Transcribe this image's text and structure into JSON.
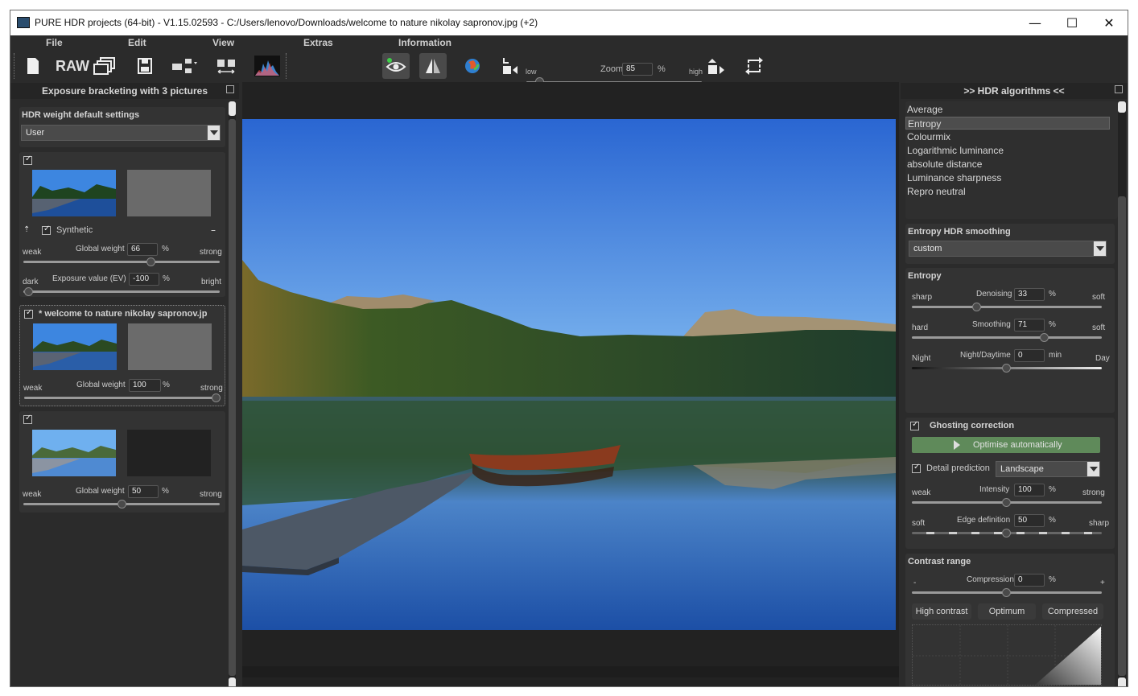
{
  "window": {
    "title": "PURE HDR projects (64-bit) - V1.15.02593 - C:/Users/lenovo/Downloads/welcome to nature nikolay sapronov.jpg (+2)",
    "minimize": "—",
    "maximize": "☐",
    "close": "✕"
  },
  "menu": [
    "File",
    "Edit",
    "View",
    "Extras",
    "Information"
  ],
  "toolbar": {
    "raw_label": "RAW",
    "zoom_label": "Zoom",
    "zoom_value": "85",
    "zoom_unit": "%",
    "low_label": "low",
    "high_label": "high",
    "slider_level_percent": 5
  },
  "left_panel": {
    "header": "Exposure bracketing with 3 pictures",
    "default_settings_title": "HDR weight default settings",
    "default_settings_value": "User",
    "synthetic_label": "Synthetic",
    "image1": {
      "weak": "weak",
      "strong": "strong",
      "global_weight_label": "Global weight",
      "global_weight": "66",
      "unit": "%",
      "dark": "dark",
      "bright": "bright",
      "ev_label": "Exposure value (EV)",
      "ev_value": "-100",
      "ev_unit": "%"
    },
    "image2": {
      "name": "* welcome to nature nikolay sapronov.jp",
      "weak": "weak",
      "strong": "strong",
      "global_weight_label": "Global weight",
      "global_weight": "100",
      "unit": "%"
    },
    "image3": {
      "weak": "weak",
      "strong": "strong",
      "global_weight_label": "Global weight",
      "global_weight": "50",
      "unit": "%"
    }
  },
  "right_panel": {
    "header": ">> HDR algorithms <<",
    "algorithms": [
      "Average",
      "Entropy",
      "Colourmix",
      "Logarithmic luminance",
      "absolute distance",
      "Luminance sharpness",
      "Repro neutral"
    ],
    "selected_algorithm": "Entropy",
    "smoothing_title": "Entropy HDR smoothing",
    "smoothing_value": "custom",
    "entropy_title": "Entropy",
    "denoising": {
      "left": "sharp",
      "label": "Denoising",
      "value": "33",
      "unit": "%",
      "right": "soft"
    },
    "smoothing": {
      "left": "hard",
      "label": "Smoothing",
      "value": "71",
      "unit": "%",
      "right": "soft"
    },
    "night_day": {
      "left": "Night",
      "label": "Night/Daytime",
      "value": "0",
      "unit": "min",
      "right": "Day"
    },
    "ghosting_title": "Ghosting correction",
    "optimise_label": "Optimise automatically",
    "detail_prediction_label": "Detail prediction",
    "detail_prediction_value": "Landscape",
    "intensity": {
      "left": "weak",
      "label": "Intensity",
      "value": "100",
      "unit": "%",
      "right": "strong"
    },
    "edge": {
      "left": "soft",
      "label": "Edge definition",
      "value": "50",
      "unit": "%",
      "right": "sharp"
    },
    "contrast_title": "Contrast range",
    "compression": {
      "left": "-",
      "label": "Compression",
      "value": "0",
      "unit": "%",
      "right": "+"
    },
    "presets": [
      "High contrast",
      "Optimum",
      "Compressed"
    ]
  },
  "colors": {
    "accent_green": "#5f8a5a",
    "panel_bg": "#2b2b2b",
    "sky_top": "#2f6fcf"
  }
}
